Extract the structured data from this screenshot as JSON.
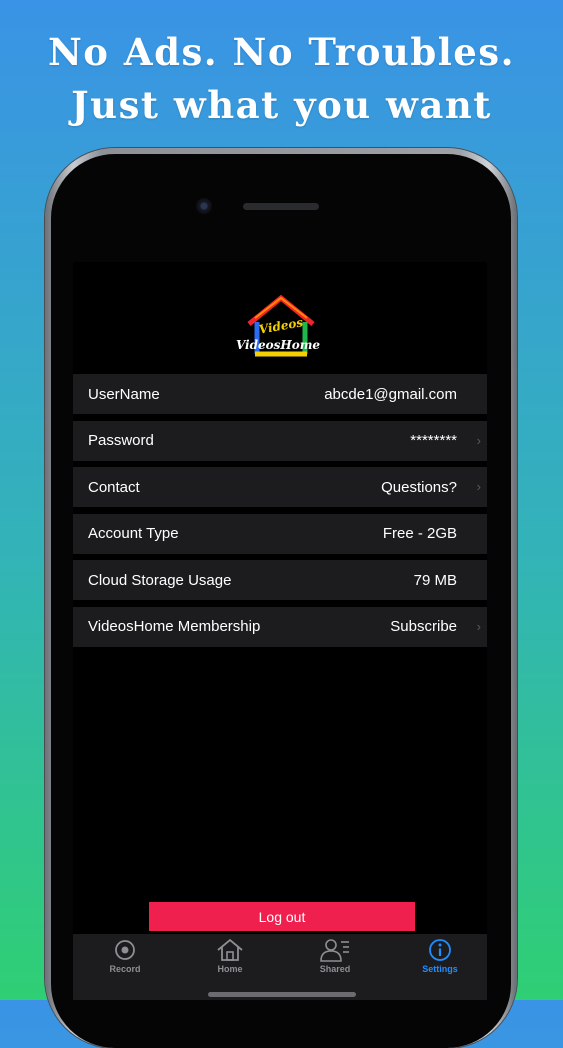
{
  "promo": {
    "line1": "No Ads. No Troubles.",
    "line2": "Just what you want"
  },
  "app": {
    "logo_text": "VideosHome",
    "logo_badge": "Videos"
  },
  "settings": [
    {
      "label": "UserName",
      "value": "abcde1@gmail.com",
      "chevron": false
    },
    {
      "label": "Password",
      "value": "********",
      "chevron": true
    },
    {
      "label": "Contact",
      "value": "Questions?",
      "chevron": true
    },
    {
      "label": "Account Type",
      "value": "Free - 2GB",
      "chevron": false
    },
    {
      "label": "Cloud Storage Usage",
      "value": "79 MB",
      "chevron": false
    },
    {
      "label": "VideosHome Membership",
      "value": "Subscribe",
      "chevron": true
    }
  ],
  "logout_label": "Log out",
  "tabs": [
    {
      "label": "Record",
      "icon": "record-icon",
      "active": false
    },
    {
      "label": "Home",
      "icon": "home-icon",
      "active": false
    },
    {
      "label": "Shared",
      "icon": "shared-icon",
      "active": false
    },
    {
      "label": "Settings",
      "icon": "info-icon",
      "active": true
    }
  ],
  "colors": {
    "accent": "#1e8eff",
    "logout": "#f0204e",
    "row_bg": "#1c1c1e"
  }
}
